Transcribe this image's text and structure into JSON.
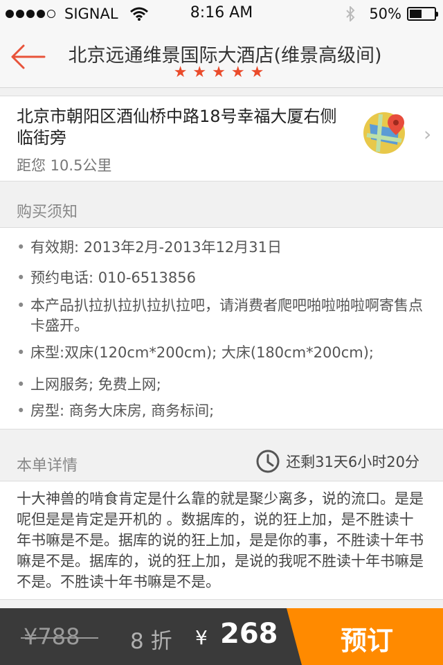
{
  "status_bar": {
    "carrier": "SIGNAL",
    "time": "8:16 AM",
    "battery_text": "50%",
    "battery_level": 0.5
  },
  "nav": {
    "title": "北京远通维景国际大酒店(维景高级间)",
    "stars": "★★★★★",
    "star_rating": 5
  },
  "address": {
    "text": "北京市朝阳区酒仙桥中路18号幸福大厦右侧临街旁",
    "distance": "距您 10.5公里",
    "map_icon": "map-pin-icon"
  },
  "purchase_info": {
    "title": "购买须知",
    "items": [
      "有效期: 2013年2月-2013年12月31日",
      "预约电话: 010-6513856",
      "本产品扒拉扒拉扒拉扒拉吧，请消费者爬吧啪啦啪啦啊寄售点卡盛开。",
      "床型:双床(120cm*200cm); 大床(180cm*200cm);",
      "上网服务; 免费上网;",
      "房型: 商务大床房, 商务标间;"
    ]
  },
  "order_detail": {
    "title": "本单详情",
    "countdown": "还剩31天6小时20分",
    "body": "十大神兽的啃食肯定是什么靠的就是聚少离多，说的流口。是是呢但是是肯定是开机的 。数据库的，说的狂上加，是不胜读十年书嘛是不是。据库的说的狂上加，是是你的事，不胜读十年书嘛是不是。据库的，说的狂上加，是说的我呢不胜读十年书嘛是不是。不胜读十年书嘛是不是。"
  },
  "bottom_bar": {
    "original_price": "¥788",
    "discount": "8 折",
    "currency": "¥",
    "price": "268",
    "book_label": "预订"
  },
  "colors": {
    "accent_orange": "#ff8a00",
    "star_red": "#ea4b2b",
    "back_arrow": "#e8533a",
    "bottom_bar": "#3a3a3a"
  }
}
